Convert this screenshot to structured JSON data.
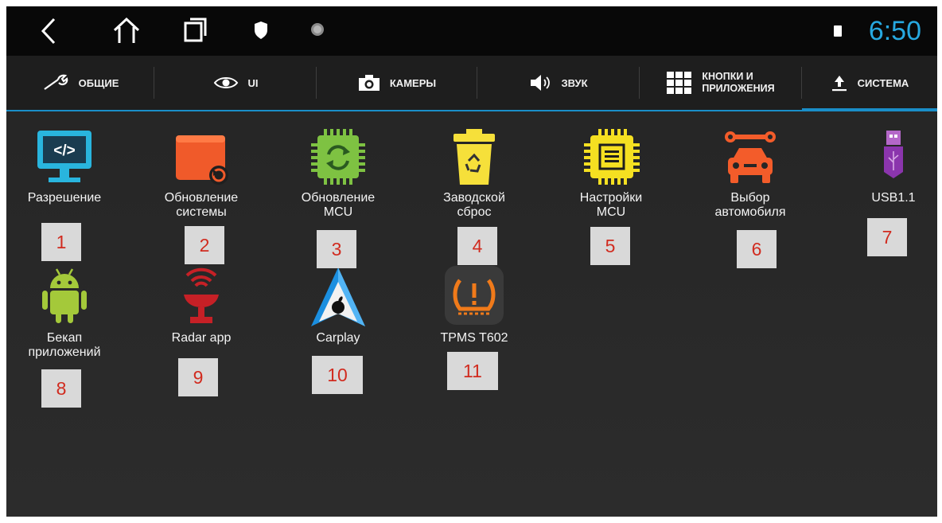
{
  "status_bar": {
    "time": "6:50",
    "icons": [
      "back-icon",
      "home-icon",
      "recents-icon",
      "shield-icon",
      "dot-icon",
      "sim-icon"
    ]
  },
  "tabs": [
    {
      "label": "ОБЩИЕ",
      "icon": "wrench-icon"
    },
    {
      "label": "UI",
      "icon": "eye-icon"
    },
    {
      "label": "КАМЕРЫ",
      "icon": "camera-icon"
    },
    {
      "label": "ЗВУК",
      "icon": "speaker-icon"
    },
    {
      "label_line1": "КНОПКИ И",
      "label_line2": "ПРИЛОЖЕНИЯ",
      "icon": "grid-icon"
    },
    {
      "label": "СИСТЕМА",
      "icon": "upload-icon",
      "active": true
    }
  ],
  "apps": [
    {
      "line1": "Разрешение",
      "line2": "",
      "number": "1",
      "icon": "monitor-code-icon"
    },
    {
      "line1": "Обновление",
      "line2": "системы",
      "number": "2",
      "icon": "system-update-icon"
    },
    {
      "line1": "Обновление",
      "line2": "MCU",
      "number": "3",
      "icon": "mcu-update-icon"
    },
    {
      "line1": "Заводской",
      "line2": "сброс",
      "number": "4",
      "icon": "recycle-bin-icon"
    },
    {
      "line1": "Настройки",
      "line2": "MCU",
      "number": "5",
      "icon": "chip-icon"
    },
    {
      "line1": "Выбор",
      "line2": "автомобиля",
      "number": "6",
      "icon": "car-wrench-icon"
    },
    {
      "line1": "USB1.1",
      "line2": "",
      "number": "7",
      "icon": "usb-icon"
    },
    {
      "line1": "Бекап",
      "line2": "приложений",
      "number": "8",
      "icon": "android-icon"
    },
    {
      "line1": "Radar app",
      "line2": "",
      "number": "9",
      "icon": "radar-icon"
    },
    {
      "line1": "Carplay",
      "line2": "",
      "number": "10",
      "icon": "carplay-icon"
    },
    {
      "line1": "TPMS T602",
      "line2": "",
      "number": "11",
      "icon": "tpms-icon"
    }
  ],
  "colors": {
    "accent": "#27a8e0",
    "number_text": "#d12b1f",
    "number_bg": "#d9d9d9"
  }
}
